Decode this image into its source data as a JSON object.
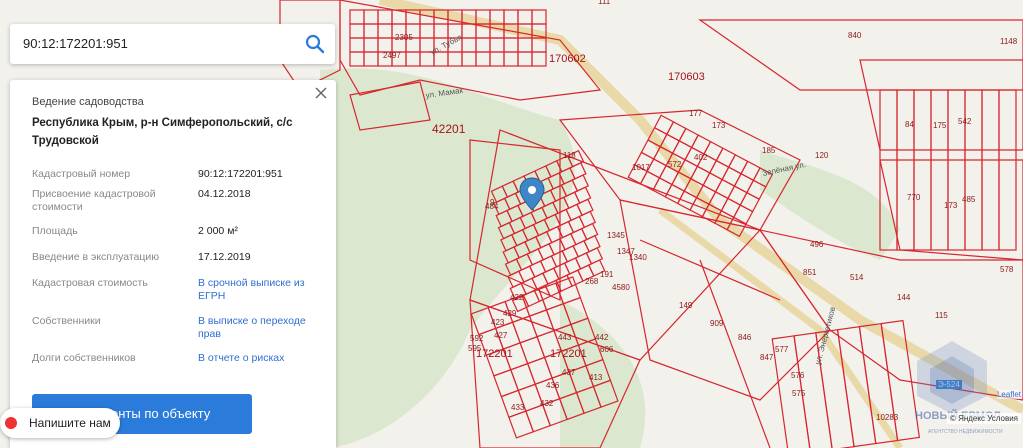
{
  "search": {
    "value": "90:12:172201:951",
    "icon": "search-icon"
  },
  "panel": {
    "type": "Ведение садоводства",
    "address": "Республика Крым, р-н Симферопольский, с/с Трудовской",
    "rows": [
      {
        "label": "Кадастровый номер",
        "value": "90:12:172201:951",
        "link": false
      },
      {
        "label": "Присвоение кадастровой стоимости",
        "value": "04.12.2018",
        "link": false
      },
      {
        "label": "Площадь",
        "value": "2 000 м²",
        "link": false
      },
      {
        "label": "Введение в эксплуатацию",
        "value": "17.12.2019",
        "link": false
      },
      {
        "label": "Кадастровая стоимость",
        "value": "В срочной выписке из ЕГРН",
        "link": true
      },
      {
        "label": "Собственники",
        "value": "В выписке о переходе прав",
        "link": true
      },
      {
        "label": "Долги собственников",
        "value": "В отчете о рисках",
        "link": true
      }
    ],
    "docs_button": "Документы по объекту",
    "close_icon": "close-icon"
  },
  "chat": {
    "label": "Напишите нам"
  },
  "map": {
    "colors": {
      "parcel": "#d7262e",
      "forest": "#dbe8cf",
      "bg": "#f2f1ec",
      "road": "#e9d9a8"
    },
    "big_labels": [
      "42201",
      "172201",
      "172201",
      "170602",
      "170603"
    ],
    "labels": [
      "2305",
      "2497",
      "840",
      "1148",
      "111",
      "118",
      "1017",
      "572",
      "402",
      "177",
      "173",
      "185",
      "120",
      "84",
      "175",
      "542",
      "770",
      "173",
      "485",
      "496",
      "851",
      "514",
      "144",
      "578",
      "4580",
      "149",
      "909",
      "846",
      "847",
      "577",
      "576",
      "575",
      "10283",
      "115",
      "191",
      "1345",
      "1347",
      "268",
      "1340",
      "484",
      "9",
      "443",
      "442",
      "437",
      "436",
      "432",
      "433",
      "423",
      "427",
      "429",
      "422",
      "592",
      "595",
      "413",
      "606"
    ],
    "streets": [
      "ул. Тубья",
      "ул. Мамак",
      "Зелёная ул.",
      "ул. Энергетиков"
    ],
    "highway_badge": "Э-524",
    "attribution": "© Яндекс Условия",
    "leaflet": "Leaflet",
    "watermark_icon": "logo-icon"
  }
}
